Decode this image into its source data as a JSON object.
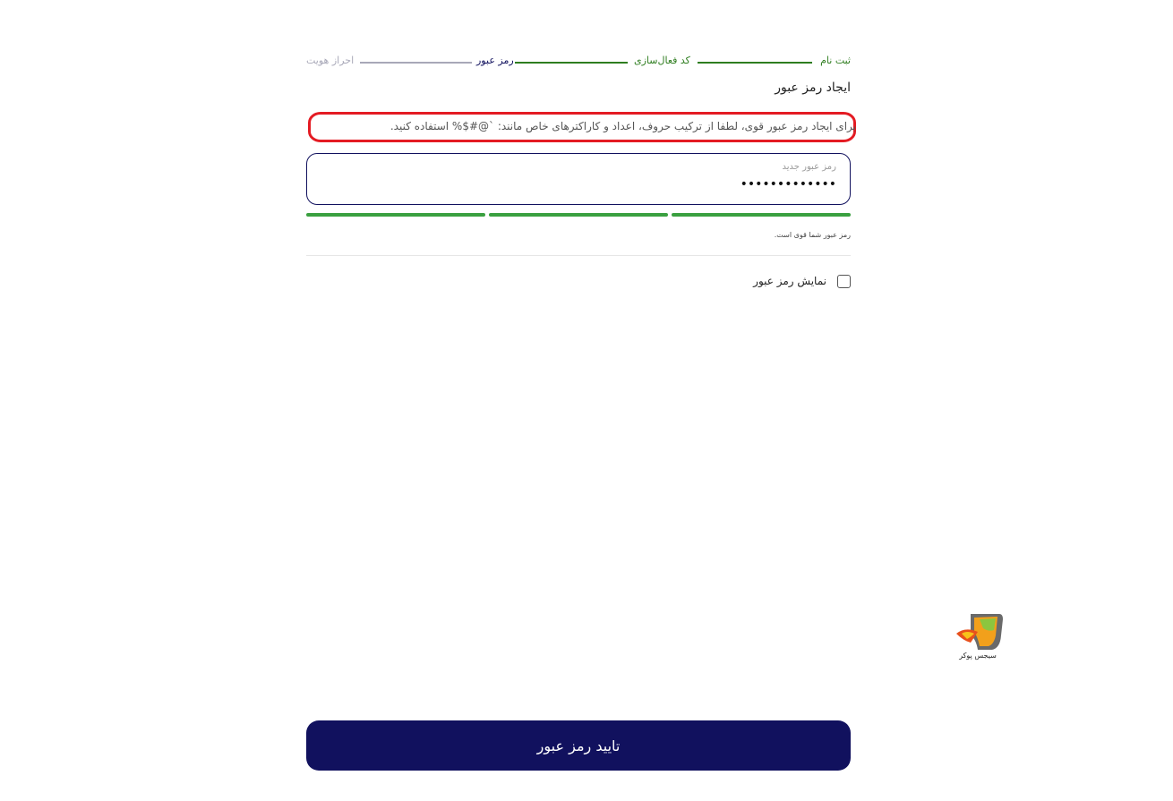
{
  "stepper": {
    "steps": [
      {
        "label": "ثبت نام",
        "state": "done"
      },
      {
        "label": "کد فعال‌سازی",
        "state": "done"
      },
      {
        "label": "رمز عبور",
        "state": "current"
      },
      {
        "label": "احراز هویت",
        "state": "pending"
      }
    ]
  },
  "title": "ایجاد رمز عبور",
  "hint": "برای ایجاد رمز عبور قوی، لطفا از ترکیب حروف، اعداد و کاراکترهای خاص مانند: `@#$% استفاده کنید.",
  "password": {
    "label": "رمز عبور جدید",
    "value": "•••••••••••••"
  },
  "strength": {
    "bars": 3,
    "filled": 3,
    "text": "رمز عبور شما قوی است."
  },
  "show_password": {
    "label": "نمایش رمز عبور",
    "checked": false
  },
  "logo": {
    "text": "سیجس پوکر"
  },
  "submit_label": "تایید رمز عبور",
  "colors": {
    "primary": "#11115e",
    "done": "#2e7d1f",
    "pending": "#a8a8b8",
    "strong": "#3aa040",
    "highlight": "#e41b23"
  }
}
